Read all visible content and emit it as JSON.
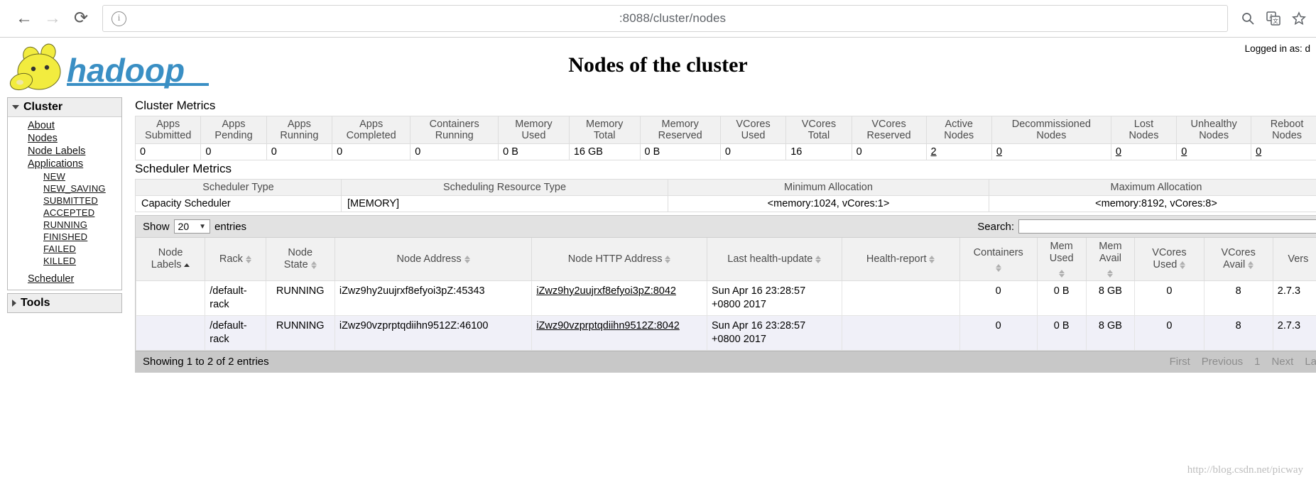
{
  "browser": {
    "back_icon": "arrow-left-icon",
    "forward_icon": "arrow-right-icon",
    "reload_icon": "reload-icon",
    "info_icon": "info-circle-icon",
    "url": ":8088/cluster/nodes",
    "zoom_icon": "magnifier-icon",
    "translate_icon": "translate-icon",
    "bookmark_icon": "star-icon"
  },
  "header": {
    "logo_text": "hadoop",
    "title": "Nodes of the cluster",
    "logged_in": "Logged in as: d"
  },
  "sidebar": {
    "cluster": {
      "label": "Cluster",
      "caret": "caret-down-icon",
      "items": [
        {
          "label": "About"
        },
        {
          "label": "Nodes"
        },
        {
          "label": "Node Labels"
        },
        {
          "label": "Applications"
        }
      ],
      "app_states": [
        "NEW",
        "NEW_SAVING",
        "SUBMITTED",
        "ACCEPTED",
        "RUNNING",
        "FINISHED",
        "FAILED",
        "KILLED"
      ],
      "scheduler": "Scheduler"
    },
    "tools": {
      "label": "Tools",
      "caret": "caret-right-icon"
    }
  },
  "cluster_metrics": {
    "title": "Cluster Metrics",
    "columns": [
      {
        "l1": "Apps",
        "l2": "Submitted"
      },
      {
        "l1": "Apps",
        "l2": "Pending"
      },
      {
        "l1": "Apps",
        "l2": "Running"
      },
      {
        "l1": "Apps",
        "l2": "Completed"
      },
      {
        "l1": "Containers",
        "l2": "Running"
      },
      {
        "l1": "Memory",
        "l2": "Used"
      },
      {
        "l1": "Memory",
        "l2": "Total"
      },
      {
        "l1": "Memory",
        "l2": "Reserved"
      },
      {
        "l1": "VCores",
        "l2": "Used"
      },
      {
        "l1": "VCores",
        "l2": "Total"
      },
      {
        "l1": "VCores",
        "l2": "Reserved"
      },
      {
        "l1": "Active",
        "l2": "Nodes"
      },
      {
        "l1": "Decommissioned",
        "l2": "Nodes"
      },
      {
        "l1": "Lost",
        "l2": "Nodes"
      },
      {
        "l1": "Unhealthy",
        "l2": "Nodes"
      },
      {
        "l1": "Reboot",
        "l2": "Nodes"
      }
    ],
    "values": [
      {
        "v": "0",
        "link": false
      },
      {
        "v": "0",
        "link": false
      },
      {
        "v": "0",
        "link": false
      },
      {
        "v": "0",
        "link": false
      },
      {
        "v": "0",
        "link": false
      },
      {
        "v": "0 B",
        "link": false
      },
      {
        "v": "16 GB",
        "link": false
      },
      {
        "v": "0 B",
        "link": false
      },
      {
        "v": "0",
        "link": false
      },
      {
        "v": "16",
        "link": false
      },
      {
        "v": "0",
        "link": false
      },
      {
        "v": "2",
        "link": true
      },
      {
        "v": "0",
        "link": true
      },
      {
        "v": "0",
        "link": true
      },
      {
        "v": "0",
        "link": true
      },
      {
        "v": "0",
        "link": true
      }
    ]
  },
  "scheduler_metrics": {
    "title": "Scheduler Metrics",
    "columns": [
      "Scheduler Type",
      "Scheduling Resource Type",
      "Minimum Allocation",
      "Maximum Allocation"
    ],
    "row": [
      "Capacity Scheduler",
      "[MEMORY]",
      "<memory:1024, vCores:1>",
      "<memory:8192, vCores:8>"
    ]
  },
  "nodes_table": {
    "show_label": "Show",
    "entries_label": "entries",
    "page_size": "20",
    "page_size_arrow": "▼",
    "search_label": "Search:",
    "search_value": "",
    "columns": [
      {
        "l1": "Node",
        "l2": "Labels",
        "sort": "asc"
      },
      {
        "l1": "Rack",
        "l2": "",
        "sort": "both"
      },
      {
        "l1": "Node",
        "l2": "State",
        "sort": "both"
      },
      {
        "l1": "Node Address",
        "l2": "",
        "sort": "both"
      },
      {
        "l1": "Node HTTP Address",
        "l2": "",
        "sort": "both"
      },
      {
        "l1": "Last health-update",
        "l2": "",
        "sort": "both"
      },
      {
        "l1": "Health-report",
        "l2": "",
        "sort": "both"
      },
      {
        "l1": "Containers",
        "l2": "",
        "sort": "both"
      },
      {
        "l1": "Mem",
        "l2": "Used",
        "sort": "both"
      },
      {
        "l1": "Mem",
        "l2": "Avail",
        "sort": "both"
      },
      {
        "l1": "VCores",
        "l2": "Used",
        "sort": "both"
      },
      {
        "l1": "VCores",
        "l2": "Avail",
        "sort": "both"
      },
      {
        "l1": "Vers",
        "l2": "",
        "sort": "both"
      }
    ],
    "rows": [
      {
        "node_labels": "",
        "rack": "/default-rack",
        "node_state": "RUNNING",
        "node_address": "iZwz9hy2uujrxf8efyoi3pZ:45343",
        "node_http_address": "iZwz9hy2uujrxf8efyoi3pZ:8042",
        "last_health_update": "Sun Apr 16 23:28:57 +0800 2017",
        "health_report": "",
        "containers": "0",
        "mem_used": "0 B",
        "mem_avail": "8 GB",
        "vcores_used": "0",
        "vcores_avail": "8",
        "version": "2.7.3"
      },
      {
        "node_labels": "",
        "rack": "/default-rack",
        "node_state": "RUNNING",
        "node_address": "iZwz90vzprptqdiihn9512Z:46100",
        "node_http_address": "iZwz90vzprptqdiihn9512Z:8042",
        "last_health_update": "Sun Apr 16 23:28:57 +0800 2017",
        "health_report": "",
        "containers": "0",
        "mem_used": "0 B",
        "mem_avail": "8 GB",
        "vcores_used": "0",
        "vcores_avail": "8",
        "version": "2.7.3"
      }
    ],
    "info": "Showing 1 to 2 of 2 entries",
    "pager": {
      "first": "First",
      "previous": "Previous",
      "page": "1",
      "next": "Next",
      "last": "La"
    }
  },
  "watermark": "http://blog.csdn.net/picway"
}
